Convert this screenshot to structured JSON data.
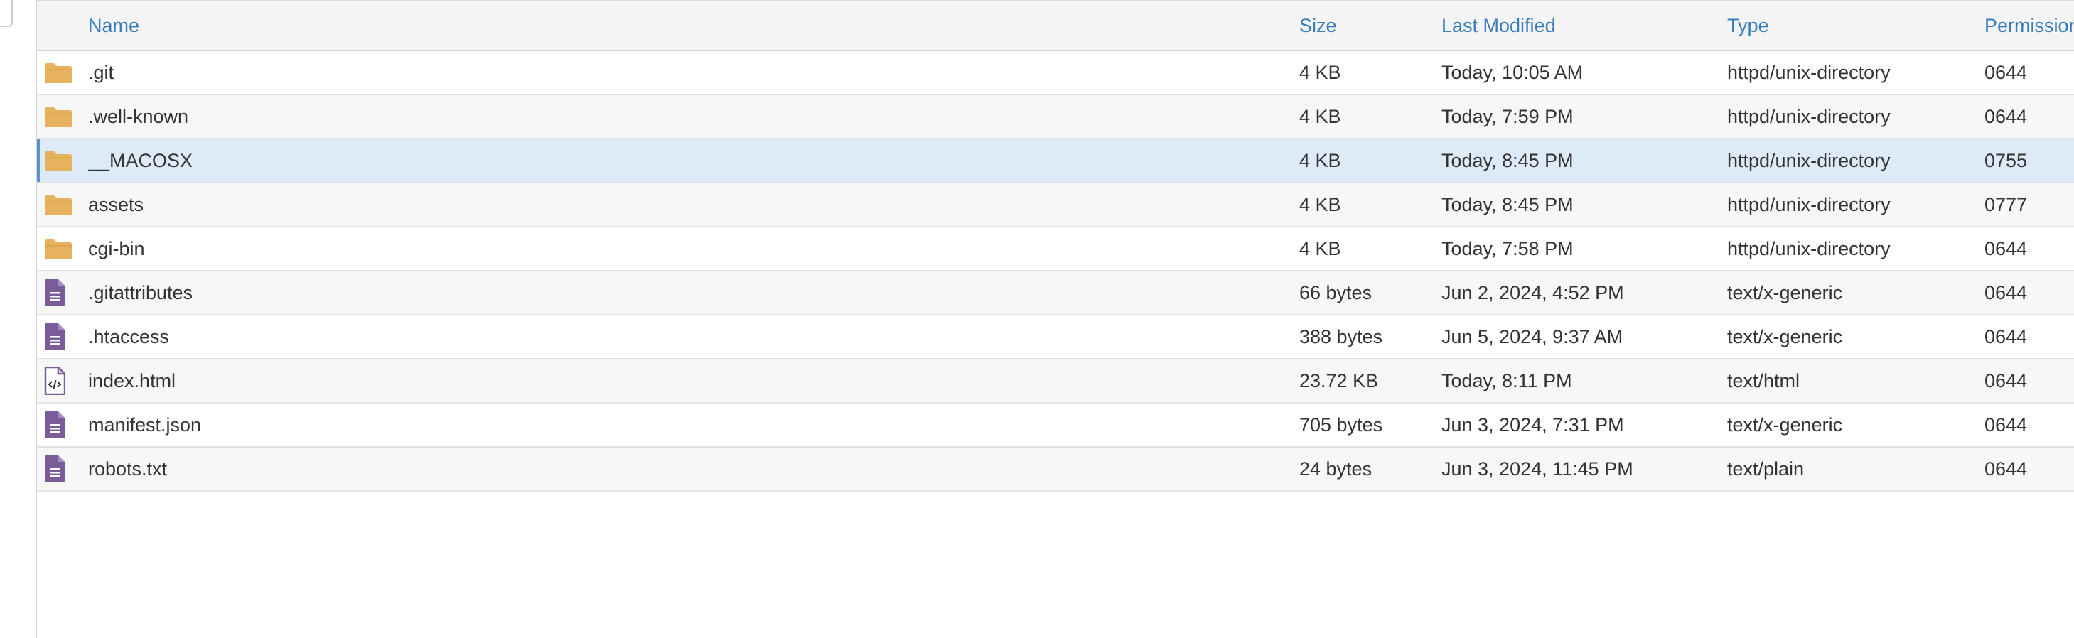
{
  "columns": {
    "name": "Name",
    "size": "Size",
    "modified": "Last Modified",
    "type": "Type",
    "permissions": "Permissions"
  },
  "colors": {
    "header_text": "#3b7dbb",
    "folder": "#e7b25d",
    "file": "#7a5c99",
    "selected_row": "#dcebf7"
  },
  "files": [
    {
      "icon": "folder-icon",
      "name": ".git",
      "size": "4 KB",
      "modified": "Today, 10:05 AM",
      "type": "httpd/unix-directory",
      "permissions": "0644",
      "selected": false
    },
    {
      "icon": "folder-icon",
      "name": ".well-known",
      "size": "4 KB",
      "modified": "Today, 7:59 PM",
      "type": "httpd/unix-directory",
      "permissions": "0644",
      "selected": false
    },
    {
      "icon": "folder-icon",
      "name": "__MACOSX",
      "size": "4 KB",
      "modified": "Today, 8:45 PM",
      "type": "httpd/unix-directory",
      "permissions": "0755",
      "selected": true
    },
    {
      "icon": "folder-icon",
      "name": "assets",
      "size": "4 KB",
      "modified": "Today, 8:45 PM",
      "type": "httpd/unix-directory",
      "permissions": "0777",
      "selected": false
    },
    {
      "icon": "folder-icon",
      "name": "cgi-bin",
      "size": "4 KB",
      "modified": "Today, 7:58 PM",
      "type": "httpd/unix-directory",
      "permissions": "0644",
      "selected": false
    },
    {
      "icon": "text-file-icon",
      "name": ".gitattributes",
      "size": "66 bytes",
      "modified": "Jun 2, 2024, 4:52 PM",
      "type": "text/x-generic",
      "permissions": "0644",
      "selected": false
    },
    {
      "icon": "text-file-icon",
      "name": ".htaccess",
      "size": "388 bytes",
      "modified": "Jun 5, 2024, 9:37 AM",
      "type": "text/x-generic",
      "permissions": "0644",
      "selected": false
    },
    {
      "icon": "code-file-icon",
      "name": "index.html",
      "size": "23.72 KB",
      "modified": "Today, 8:11 PM",
      "type": "text/html",
      "permissions": "0644",
      "selected": false
    },
    {
      "icon": "text-file-icon",
      "name": "manifest.json",
      "size": "705 bytes",
      "modified": "Jun 3, 2024, 7:31 PM",
      "type": "text/x-generic",
      "permissions": "0644",
      "selected": false
    },
    {
      "icon": "text-file-icon",
      "name": "robots.txt",
      "size": "24 bytes",
      "modified": "Jun 3, 2024, 11:45 PM",
      "type": "text/plain",
      "permissions": "0644",
      "selected": false
    }
  ]
}
